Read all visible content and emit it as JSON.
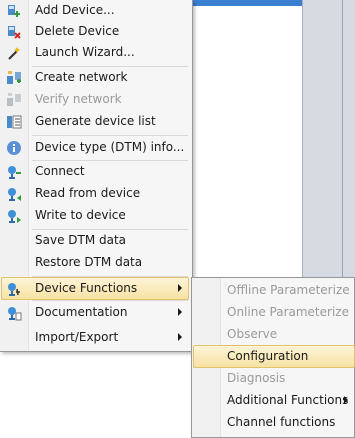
{
  "menu": {
    "items": [
      {
        "name": "add-device",
        "label": "Add Device...",
        "icon": "add-device-icon",
        "disabled": false
      },
      {
        "name": "delete-device",
        "label": "Delete Device",
        "icon": "delete-device-icon",
        "disabled": false
      },
      {
        "name": "launch-wizard",
        "label": "Launch Wizard...",
        "icon": "wand-icon",
        "disabled": false
      },
      {
        "name": "create-network",
        "label": "Create network",
        "icon": "network-create-icon",
        "disabled": false
      },
      {
        "name": "verify-network",
        "label": "Verify network",
        "icon": "network-verify-icon",
        "disabled": true
      },
      {
        "name": "generate-device-list",
        "label": "Generate device list",
        "icon": "device-list-icon",
        "disabled": false
      },
      {
        "name": "device-type-info",
        "label": "Device type (DTM) info...",
        "icon": "info-icon",
        "disabled": false
      },
      {
        "name": "connect",
        "label": "Connect",
        "icon": "connect-icon",
        "disabled": false
      },
      {
        "name": "read-from-device",
        "label": "Read from device",
        "icon": "read-device-icon",
        "disabled": false
      },
      {
        "name": "write-to-device",
        "label": "Write to device",
        "icon": "write-device-icon",
        "disabled": false
      },
      {
        "name": "save-dtm-data",
        "label": "Save DTM data",
        "icon": "",
        "disabled": false
      },
      {
        "name": "restore-dtm-data",
        "label": "Restore DTM data",
        "icon": "",
        "disabled": false
      },
      {
        "name": "device-functions",
        "label": "Device Functions",
        "icon": "device-functions-icon",
        "disabled": false
      },
      {
        "name": "documentation",
        "label": "Documentation",
        "icon": "documentation-icon",
        "disabled": false
      },
      {
        "name": "import-export",
        "label": "Import/Export",
        "icon": "",
        "disabled": false
      }
    ]
  },
  "submenu": {
    "items": [
      {
        "name": "offline-parameterize",
        "label": "Offline Parameterize",
        "disabled": true
      },
      {
        "name": "online-parameterize",
        "label": "Online Parameterize",
        "disabled": true
      },
      {
        "name": "observe",
        "label": "Observe",
        "disabled": true
      },
      {
        "name": "configuration",
        "label": "Configuration",
        "disabled": false
      },
      {
        "name": "diagnosis",
        "label": "Diagnosis",
        "disabled": true
      },
      {
        "name": "additional-functions",
        "label": "Additional Functions",
        "disabled": false
      },
      {
        "name": "channel-functions",
        "label": "Channel functions",
        "disabled": false
      }
    ]
  },
  "colors": {
    "highlight": "#f7e2a3",
    "accent": "#3b7fd1"
  }
}
